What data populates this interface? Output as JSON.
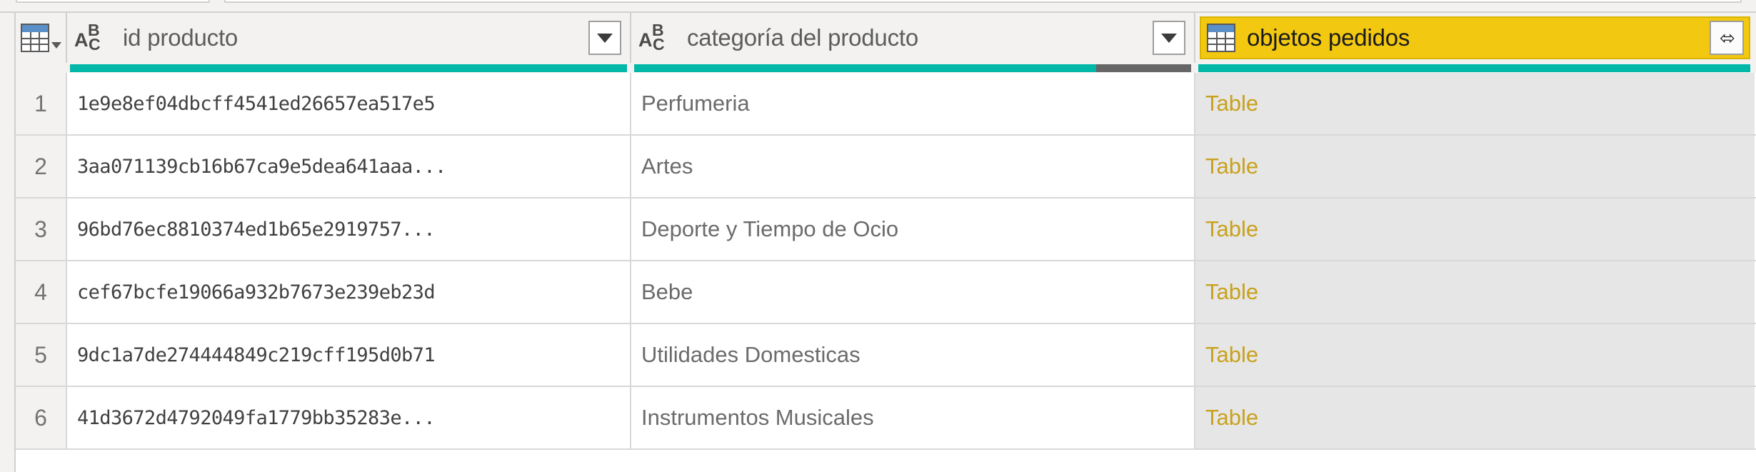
{
  "grid": {
    "columns": [
      {
        "key": "rownum",
        "label": "",
        "type_icon": "table-corner-icon",
        "selected": false,
        "has_filter": false
      },
      {
        "key": "id_producto",
        "label": "id producto",
        "type_icon": "abc-text-type-icon",
        "selected": false,
        "has_filter": true,
        "quality": {
          "valid_color": "#00b7a8",
          "error_color": "#666666",
          "error_pct": 0
        }
      },
      {
        "key": "categoria_del_producto",
        "label": "categoría del producto",
        "type_icon": "abc-text-type-icon",
        "selected": false,
        "has_filter": true,
        "quality": {
          "valid_color": "#00b7a8",
          "error_color": "#666666",
          "error_pct": 17
        }
      },
      {
        "key": "objetos_pedidos",
        "label": "objetos pedidos",
        "type_icon": "table-type-icon",
        "selected": true,
        "has_filter": false,
        "has_expand": true,
        "expand_glyph": "⬄",
        "quality": {
          "valid_color": "#00b7a8",
          "error_color": "#666666",
          "error_pct": 0
        }
      }
    ],
    "rows": [
      {
        "rownum": "1",
        "id_producto": "1e9e8ef04dbcff4541ed26657ea517e5",
        "categoria_del_producto": "Perfumeria",
        "objetos_pedidos": "Table"
      },
      {
        "rownum": "2",
        "id_producto": "3aa071139cb16b67ca9e5dea641aaa...",
        "categoria_del_producto": "Artes",
        "objetos_pedidos": "Table"
      },
      {
        "rownum": "3",
        "id_producto": "96bd76ec8810374ed1b65e2919757...",
        "categoria_del_producto": "Deporte y Tiempo de Ocio",
        "objetos_pedidos": "Table"
      },
      {
        "rownum": "4",
        "id_producto": "cef67bcfe19066a932b7673e239eb23d",
        "categoria_del_producto": "Bebe",
        "objetos_pedidos": "Table"
      },
      {
        "rownum": "5",
        "id_producto": "9dc1a7de274444849c219cff195d0b71",
        "categoria_del_producto": "Utilidades Domesticas",
        "objetos_pedidos": "Table"
      },
      {
        "rownum": "6",
        "id_producto": "41d3672d4792049fa1779bb35283e...",
        "categoria_del_producto": "Instrumentos Musicales",
        "objetos_pedidos": "Table"
      }
    ]
  },
  "theme": {
    "selected_header_bg": "#f2c811",
    "selected_column_bg": "#e6e6e6",
    "table_link_color": "#c8a11c",
    "quality_valid": "#00b7a8",
    "quality_error": "#666666",
    "header_bg": "#f3f2f1",
    "grid_line": "#d8d8d8"
  }
}
